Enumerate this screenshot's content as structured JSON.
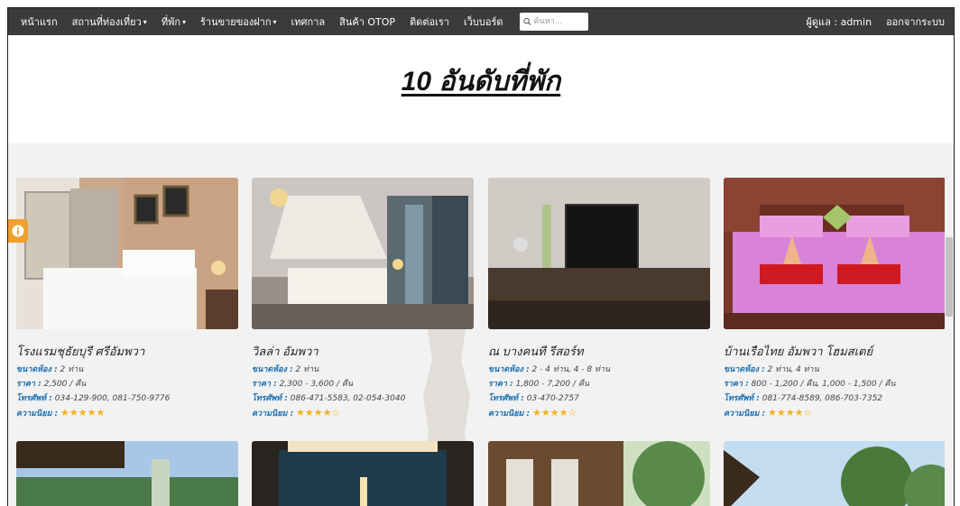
{
  "nav": {
    "items": [
      {
        "label": "หน้าแรก",
        "dropdown": false
      },
      {
        "label": "สถานที่ท่องเที่ยว",
        "dropdown": true
      },
      {
        "label": "ที่พัก",
        "dropdown": true
      },
      {
        "label": "ร้านขายของฝาก",
        "dropdown": true
      },
      {
        "label": "เทศกาล",
        "dropdown": false
      },
      {
        "label": "สินค้า OTOP",
        "dropdown": false
      },
      {
        "label": "ติดต่อเรา",
        "dropdown": false
      },
      {
        "label": "เว็บบอร์ด",
        "dropdown": false
      }
    ],
    "search_placeholder": "ค้นหา...",
    "user_label": "ผู้ดูแล : admin",
    "logout_label": "ออกจากระบบ",
    "caret": "▾"
  },
  "page_title": "10 อันดับที่พัก",
  "labels": {
    "room": "ขนาดห้อง :",
    "price": "ราคา :",
    "phone": "โทรศัพท์ :",
    "rating": "ความนิยม :"
  },
  "colors": {
    "navbar": "#3b3b3b",
    "accent": "#1a6fb0",
    "star": "#f2b01e",
    "info_tab": "#f0a030"
  },
  "cards": [
    {
      "name": "โรงแรมชุธัยบุรี ศรีอัมพวา",
      "room": "2 ท่าน",
      "price": "2,500 / คืน",
      "phone": "034-129-900, 081-750-9776",
      "rating": 5,
      "stars": "★★★★★"
    },
    {
      "name": "วิลล่า อัมพวา",
      "room": "2 ท่าน",
      "price": "2,300 - 3,600 / คืน",
      "phone": "086-471-5583, 02-054-3040",
      "rating": 4,
      "stars": "★★★★☆"
    },
    {
      "name": "ณ บางคนที รีสอร์ท",
      "room": "2 - 4 ท่าน, 4 - 8 ท่าน",
      "price": "1,800 - 7,200 / คืน",
      "phone": "03-470-2757",
      "rating": 4,
      "stars": "★★★★☆"
    },
    {
      "name": "บ้านเรือไทย อัมพวา โฮมสเตย์",
      "room": "2 ท่าน, 4 ท่าน",
      "price": "800 - 1,200 / คืน, 1,000 - 1,500 / คืน",
      "phone": "081-774-8589, 086-703-7352",
      "rating": 4,
      "stars": "★★★★☆"
    }
  ]
}
